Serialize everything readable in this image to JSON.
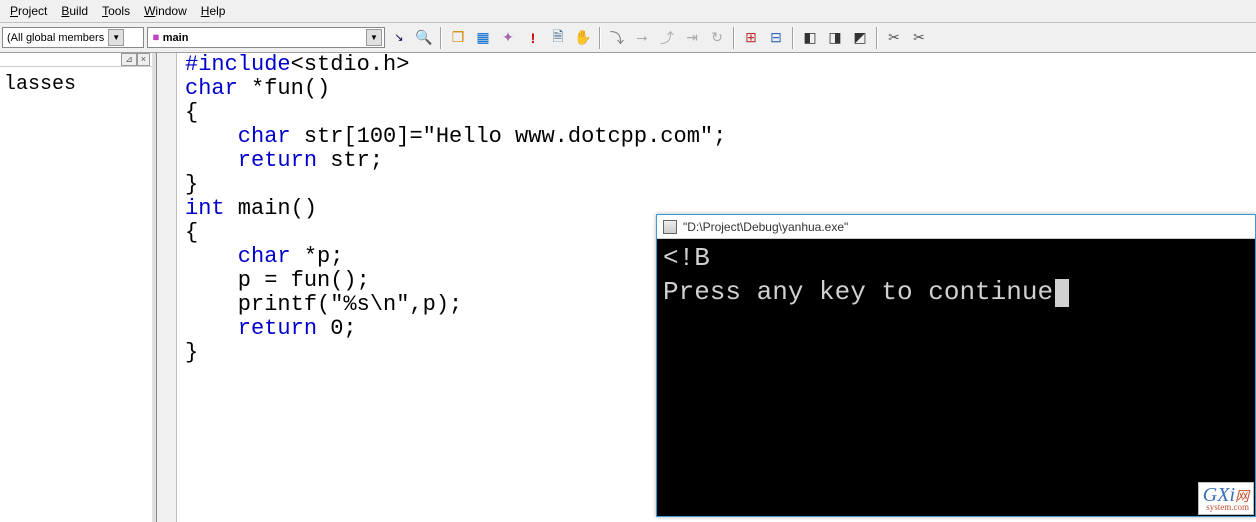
{
  "menu": {
    "project": "Project",
    "build": "Build",
    "tools": "Tools",
    "window": "Window",
    "help": "Help"
  },
  "toolbar": {
    "scope_combo": "(All global members",
    "symbol_combo": "main"
  },
  "sidebar": {
    "classes_label": "lasses"
  },
  "code": {
    "l1a": "#include",
    "l1b": "<stdio.h>",
    "l2a": "char",
    "l2b": " *fun()",
    "l3": "{",
    "l4a": "    char",
    "l4b": " str[100]=\"Hello www.dotcpp.com\";",
    "l5a": "    return",
    "l5b": " str;",
    "l6": "}",
    "l7a": "int",
    "l7b": " main()",
    "l8": "{",
    "l9a": "    char",
    "l9b": " *p;",
    "l10": "    p = fun();",
    "l11": "    printf(\"%s\\n\",p);",
    "l12a": "    return",
    "l12b": " 0;",
    "l13": "}"
  },
  "console": {
    "title": "\"D:\\Project\\Debug\\yanhua.exe\"",
    "line1": "<!B",
    "line2": "Press any key to continue"
  },
  "watermark": {
    "main": "GXi",
    "sub": "system.com"
  }
}
